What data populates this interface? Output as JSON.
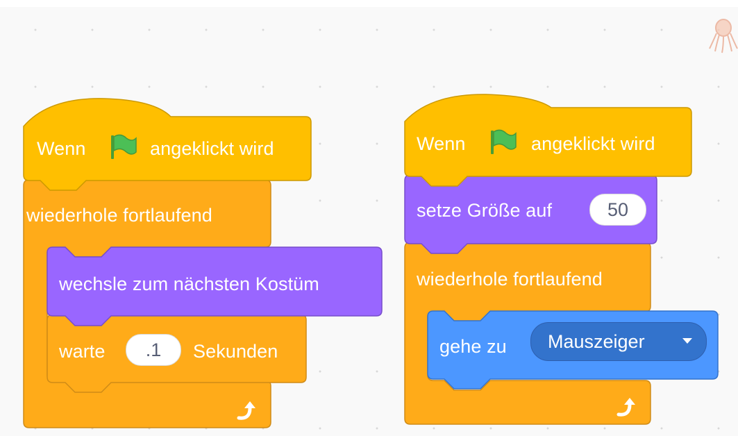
{
  "scripts": [
    {
      "hat": {
        "prefix": "Wenn",
        "suffix": "angeklickt wird",
        "flag_icon": "green-flag-icon"
      },
      "forever": {
        "label": "wiederhole fortlaufend",
        "loop_icon": "loop-arrow-icon"
      },
      "inner": [
        {
          "label": "wechsle zum nächsten Kostüm"
        },
        {
          "before": "warte",
          "value": ".1",
          "after": "Sekunden"
        }
      ]
    },
    {
      "hat": {
        "prefix": "Wenn",
        "suffix": "angeklickt wird",
        "flag_icon": "green-flag-icon"
      },
      "set_size": {
        "label": "setze Größe auf",
        "value": "50"
      },
      "forever": {
        "label": "wiederhole fortlaufend",
        "loop_icon": "loop-arrow-icon"
      },
      "inner": [
        {
          "label": "gehe zu",
          "dropdown": "Mauszeiger"
        }
      ]
    }
  ],
  "sprite_icon": "octopus-sprite-icon",
  "colors": {
    "events": "#ffbf00",
    "events_border": "#cc9900",
    "control": "#ffab19",
    "control_border": "#cf8b17",
    "looks": "#9966ff",
    "looks_border": "#774dcb",
    "motion": "#4c97ff",
    "motion_border": "#3373cc"
  }
}
